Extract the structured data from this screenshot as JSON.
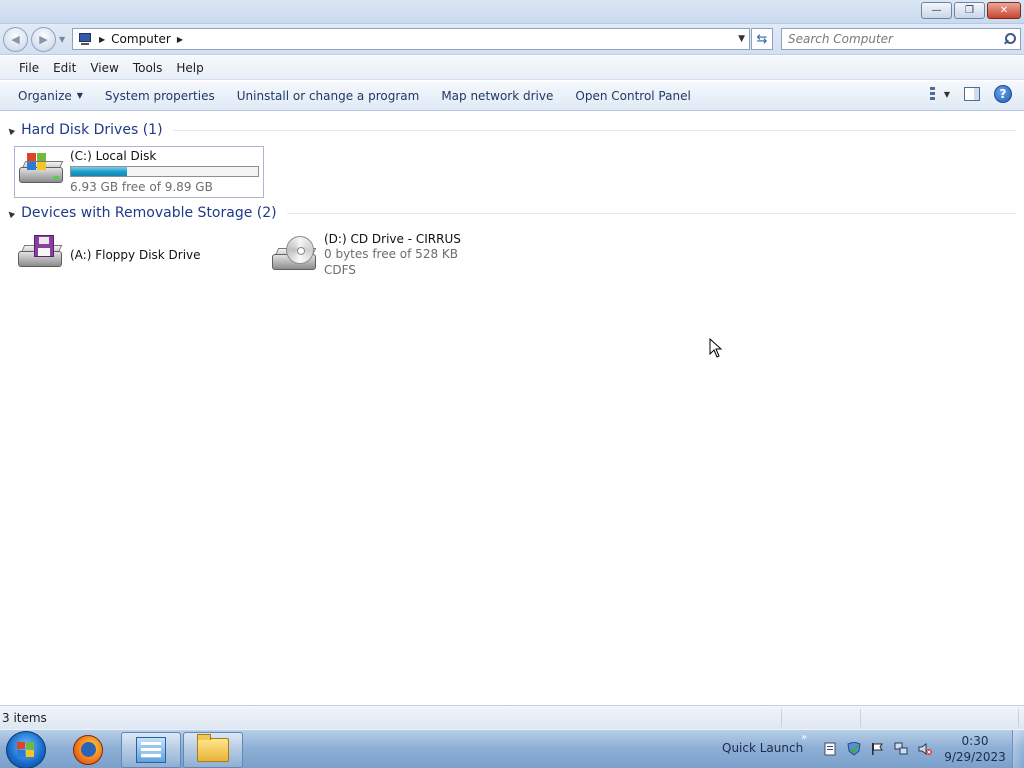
{
  "window": {
    "minimize_glyph": "—",
    "maximize_glyph": "❐",
    "close_glyph": "✕"
  },
  "address": {
    "crumbs": [
      "Computer"
    ],
    "search_placeholder": "Search Computer"
  },
  "menu": {
    "items": [
      {
        "label": "File"
      },
      {
        "label": "Edit"
      },
      {
        "label": "View"
      },
      {
        "label": "Tools"
      },
      {
        "label": "Help"
      }
    ]
  },
  "commands": {
    "organize": "Organize",
    "system_properties": "System properties",
    "uninstall": "Uninstall or change a program",
    "map_drive": "Map network drive",
    "control_panel": "Open Control Panel",
    "help_glyph": "?"
  },
  "groups": {
    "hard_disks": {
      "title": "Hard Disk Drives (1)",
      "drives": [
        {
          "name": "(C:) Local Disk",
          "free_text": "6.93 GB free of 9.89 GB",
          "used_fraction": 0.3
        }
      ]
    },
    "removable": {
      "title": "Devices with Removable Storage (2)",
      "drives": [
        {
          "name": "(A:) Floppy Disk Drive"
        },
        {
          "name": "(D:) CD Drive - CIRRUS",
          "free_text": "0 bytes free of 528 KB",
          "fs": "CDFS"
        }
      ]
    }
  },
  "status": {
    "items_text": "3 items"
  },
  "taskbar": {
    "quick_launch": "Quick Launch",
    "chevron": "»",
    "time": "0:30",
    "date": "9/29/2023"
  },
  "colors": {
    "group_title": "#1e3a8a",
    "usage_bar": "#1e9ecb"
  }
}
